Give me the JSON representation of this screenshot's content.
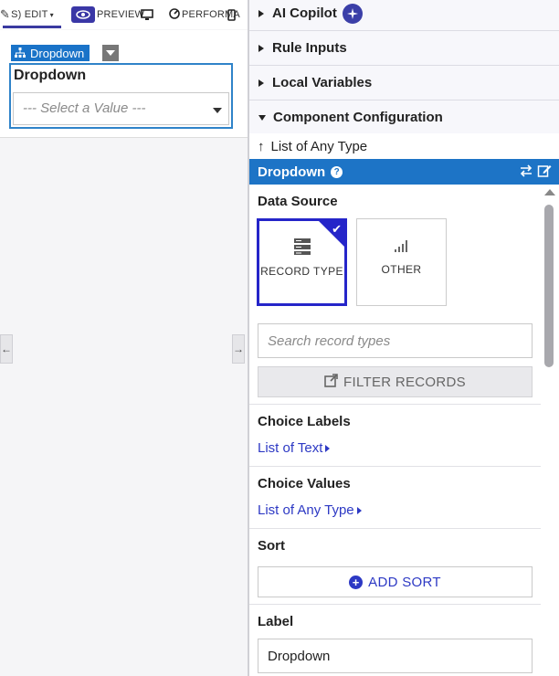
{
  "topbar": {
    "edit_label": "S) EDIT",
    "preview_label": "PREVIEW",
    "performance_label": "PERFORMA"
  },
  "canvas": {
    "component_tag": "Dropdown",
    "dropdown_label": "Dropdown",
    "dropdown_placeholder": "--- Select a Value ---"
  },
  "panel": {
    "sections": {
      "ai_copilot": "AI Copilot",
      "rule_inputs": "Rule Inputs",
      "local_variables": "Local Variables",
      "component_configuration": "Component Configuration"
    },
    "breadcrumb": "List of Any Type",
    "component_title": "Dropdown",
    "data_source": {
      "title": "Data Source",
      "record_type": "RECORD TYPE",
      "other": "OTHER"
    },
    "search": {
      "placeholder": "Search record types"
    },
    "filter_records": "FILTER RECORDS",
    "choice_labels": {
      "title": "Choice Labels",
      "value": "List of Text"
    },
    "choice_values": {
      "title": "Choice Values",
      "value": "List of Any Type"
    },
    "sort": {
      "title": "Sort",
      "add_label": "ADD SORT"
    },
    "label": {
      "title": "Label",
      "value": "Dropdown"
    }
  },
  "colors": {
    "accent": "#1d74c6",
    "selected_border": "#2525c9",
    "link": "#2d39c4",
    "copilot": "#3b3fa8"
  }
}
